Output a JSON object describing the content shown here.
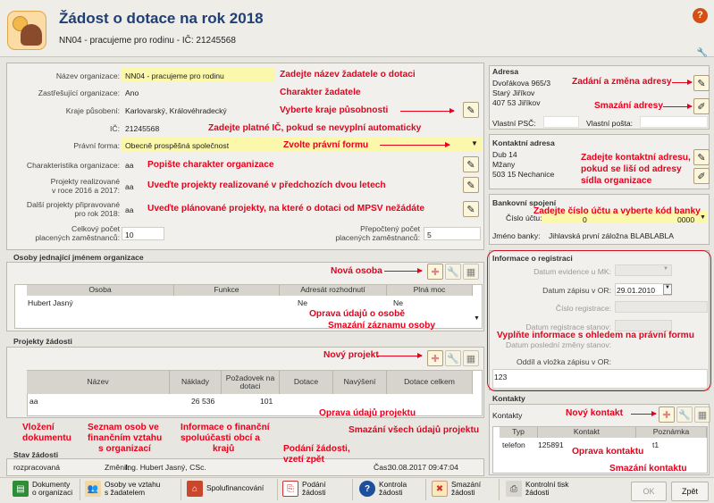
{
  "header": {
    "title": "Žádost o dotace na rok 2018",
    "subtitle": "NN04 - pracujeme pro rodinu - IČ: 21245568"
  },
  "org": {
    "name_label": "Název organizace:",
    "name_value": "NN04 - pracujeme pro rodinu",
    "name_ann": "Zadejte název žadatele o dotaci",
    "umbrella_label": "Zastřešující organizace:",
    "umbrella_value": "Ano",
    "umbrella_ann": "Charakter žadatele",
    "region_label": "Kraje působení:",
    "region_value": "Karlovarský, Královéhradecký",
    "region_ann": "Vyberte kraje působnosti",
    "ic_label": "IČ:",
    "ic_value": "21245568",
    "ic_ann": "Zadejte platné IČ, pokud se nevyplní automaticky",
    "legal_label": "Právní forma:",
    "legal_value": "Obecně prospěšná společnost",
    "legal_ann": "Zvolte právní formu",
    "char_label": "Charakteristika organizace:",
    "char_value": "aa",
    "char_ann": "Popište charakter organizace",
    "proj_label_1": "Projekty realizované",
    "proj_label_2": "v roce 2016 a 2017:",
    "proj_value": "aa",
    "proj_ann": "Uveďte projekty realizované v předchozích dvou letech",
    "next_label_1": "Další projekty připravované",
    "next_label_2": "pro rok 2018:",
    "next_value": "aa",
    "next_ann": "Uveďte plánované projekty, na které o dotaci od MPSV nežádáte",
    "emp_label_1": "Celkový počet",
    "emp_label_2": "placených zaměstnanců:",
    "emp_value": "10",
    "fte_label_1": "Přepočtený počet",
    "fte_label_2": "placených zaměstnanců:",
    "fte_value": "5"
  },
  "persons": {
    "title": "Osoby jednající jménem organizace",
    "new_ann": "Nová osoba",
    "edit_ann": "Oprava údajů o osobě",
    "del_ann": "Smazání záznamu osoby",
    "columns": [
      "Osoba",
      "Funkce",
      "Adresát rozhodnutí",
      "Plná moc"
    ],
    "rows": [
      [
        "Hubert Jasný",
        "",
        "Ne",
        "Ne"
      ]
    ]
  },
  "projects": {
    "title": "Projekty žádosti",
    "new_ann": "Nový projekt",
    "edit_ann": "Oprava údajů projektu",
    "del_ann": "Smazání všech údajů projektu",
    "columns": [
      "Název",
      "Náklady",
      "Požadovek na dotaci",
      "Dotace",
      "Navýšení",
      "Dotace celkem"
    ],
    "rows": [
      [
        "aa",
        "26 536",
        "101",
        "",
        "",
        ""
      ]
    ]
  },
  "status": {
    "title": "Stav žádosti",
    "value": "rozpracovaná",
    "changed_label": "Změnil:",
    "changed_value": "Ing. Hubert Jasný, CSc.",
    "time_label": "Čas:",
    "time_value": "30.08.2017 09:47:04"
  },
  "address": {
    "title": "Adresa",
    "lines": [
      "Dvořákova 965/3",
      "Starý Jiříkov",
      "407 53 Jiříkov"
    ],
    "add_ann": "Zadání a změna adresy",
    "del_ann": "Smazání adresy",
    "psc_label": "Vlastní PSČ:",
    "post_label": "Vlastní pošta:"
  },
  "contact_address": {
    "title": "Kontaktní adresa",
    "lines": [
      "Dub 14",
      "Mžany",
      "503 15 Nechanice"
    ],
    "ann_1": "Zadejte kontaktní adresu,",
    "ann_2": "pokud se liší od adresy",
    "ann_3": "sídla organizace"
  },
  "bank": {
    "title": "Bankovní spojení",
    "account_label": "Číslo účtu:",
    "account_value": "0",
    "code_value": "0000",
    "ann": "Zadejte číslo účtu a vyberte kód banky",
    "bank_label": "Jméno banky:",
    "bank_value": "Jihlavská první záložna BLABLABLA"
  },
  "registration": {
    "title": "Informace o registraci",
    "mk_label": "Datum evidence u MK:",
    "or_label": "Datum zápisu v OR:",
    "or_value": "29.01.2010",
    "reg_label": "Číslo registrace:",
    "stanov_label": "Datum registrace stanov:",
    "change_label": "Datum poslední změny stanov:",
    "oddil_label": "Oddíl a vložka zápisu v OR:",
    "oddil_value": "123",
    "ann": "Vyplňte informace s ohledem na právní formu"
  },
  "contacts": {
    "title": "Kontakty",
    "sub": "Kontakty",
    "new_ann": "Nový kontakt",
    "edit_ann": "Oprava kontaktu",
    "del_ann": "Smazání kontaktu",
    "columns": [
      "Typ",
      "Kontakt",
      "Poznámka"
    ],
    "rows": [
      [
        "telefon",
        "125891",
        "t1"
      ]
    ]
  },
  "bottom_ann": {
    "docs_1": "Vložení",
    "docs_2": "dokumentu",
    "persons_1": "Seznam osob ve",
    "persons_2": "finančním vztahu",
    "persons_3": "s organizací",
    "cofin_1": "Informace o finanční",
    "cofin_2": "spoluúčasti obcí a",
    "cofin_3": "krajů",
    "submit_1": "Podání žádosti,",
    "submit_2": "vzetí zpět"
  },
  "toolbar": {
    "docs_1": "Dokumenty",
    "docs_2": "o organizaci",
    "persons_1": "Osoby ve vztahu",
    "persons_2": "s žadatelem",
    "cofin": "Spolufinancování",
    "submit_1": "Podání",
    "submit_2": "žádosti",
    "check_1": "Kontrola",
    "check_2": "žádosti",
    "delete_1": "Smazání",
    "delete_2": "žádosti",
    "print_1": "Kontrolní tisk",
    "print_2": "žádosti",
    "ok": "OK",
    "back": "Zpět"
  },
  "icons": [
    "app-icon",
    "help-icon",
    "settings-icon",
    "edit-icon",
    "add-icon",
    "delete-icon",
    "dropdown-icon",
    "calendar-icon"
  ]
}
